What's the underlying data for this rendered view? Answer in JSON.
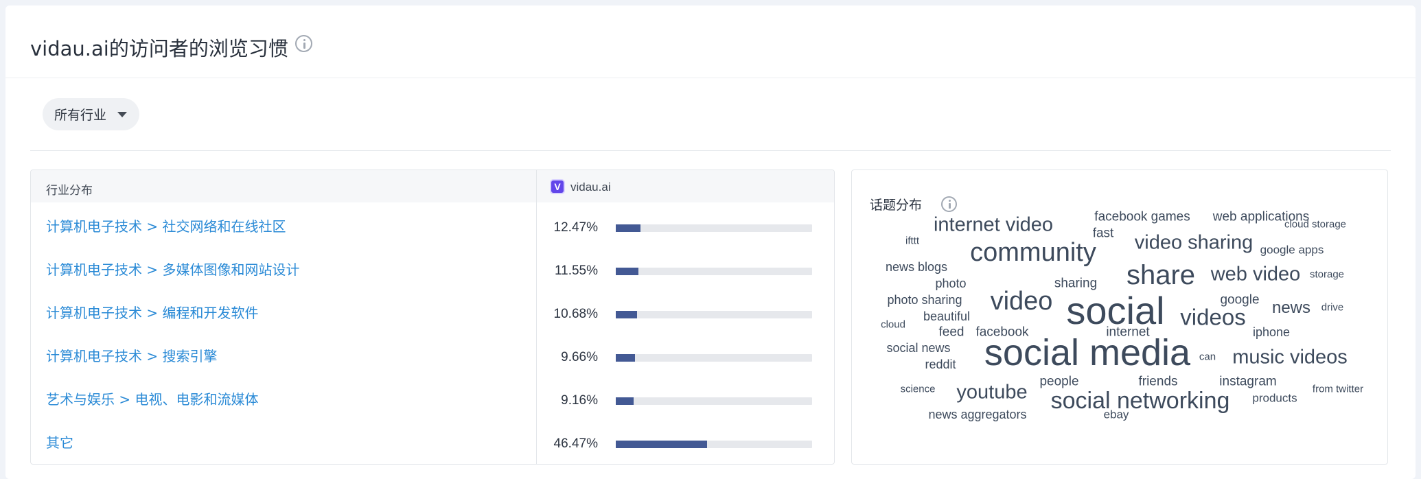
{
  "header": {
    "title": "vidau.ai的访问者的浏览习惯"
  },
  "filter": {
    "label": "所有行业"
  },
  "table": {
    "header_left": "行业分布",
    "site_name": "vidau.ai",
    "site_logo_letter": "V",
    "rows": [
      {
        "label": "计算机电子技术 > 社交网络和在线社区",
        "pct_text": "12.47%",
        "fraction": 0.1247
      },
      {
        "label": "计算机电子技术 > 多媒体图像和网站设计",
        "pct_text": "11.55%",
        "fraction": 0.1155
      },
      {
        "label": "计算机电子技术 > 编程和开发软件",
        "pct_text": "10.68%",
        "fraction": 0.1068
      },
      {
        "label": "计算机电子技术 > 搜索引擎",
        "pct_text": "9.66%",
        "fraction": 0.0966
      },
      {
        "label": "艺术与娱乐 > 电视、电影和流媒体",
        "pct_text": "9.16%",
        "fraction": 0.0916
      },
      {
        "label": "其它",
        "pct_text": "46.47%",
        "fraction": 0.4647
      }
    ]
  },
  "topics": {
    "title": "话题分布",
    "words": [
      "internet video",
      "facebook games",
      "web applications",
      "cloud storage",
      "ifttt",
      "fast",
      "community",
      "video sharing",
      "google apps",
      "news blogs",
      "share",
      "web video",
      "photo",
      "sharing",
      "storage",
      "photo sharing",
      "video",
      "google",
      "social",
      "news",
      "drive",
      "beautiful",
      "videos",
      "cloud",
      "feed",
      "facebook",
      "internet",
      "iphone",
      "social news",
      "social media",
      "can",
      "music videos",
      "reddit",
      "friends",
      "science",
      "people",
      "instagram",
      "youtube",
      "from twitter",
      "social networking",
      "products",
      "news aggregators",
      "ebay"
    ]
  },
  "colors": {
    "accent_link": "#2a8ad6",
    "bar_fill": "#435994",
    "bar_track": "#e6e8ec"
  }
}
